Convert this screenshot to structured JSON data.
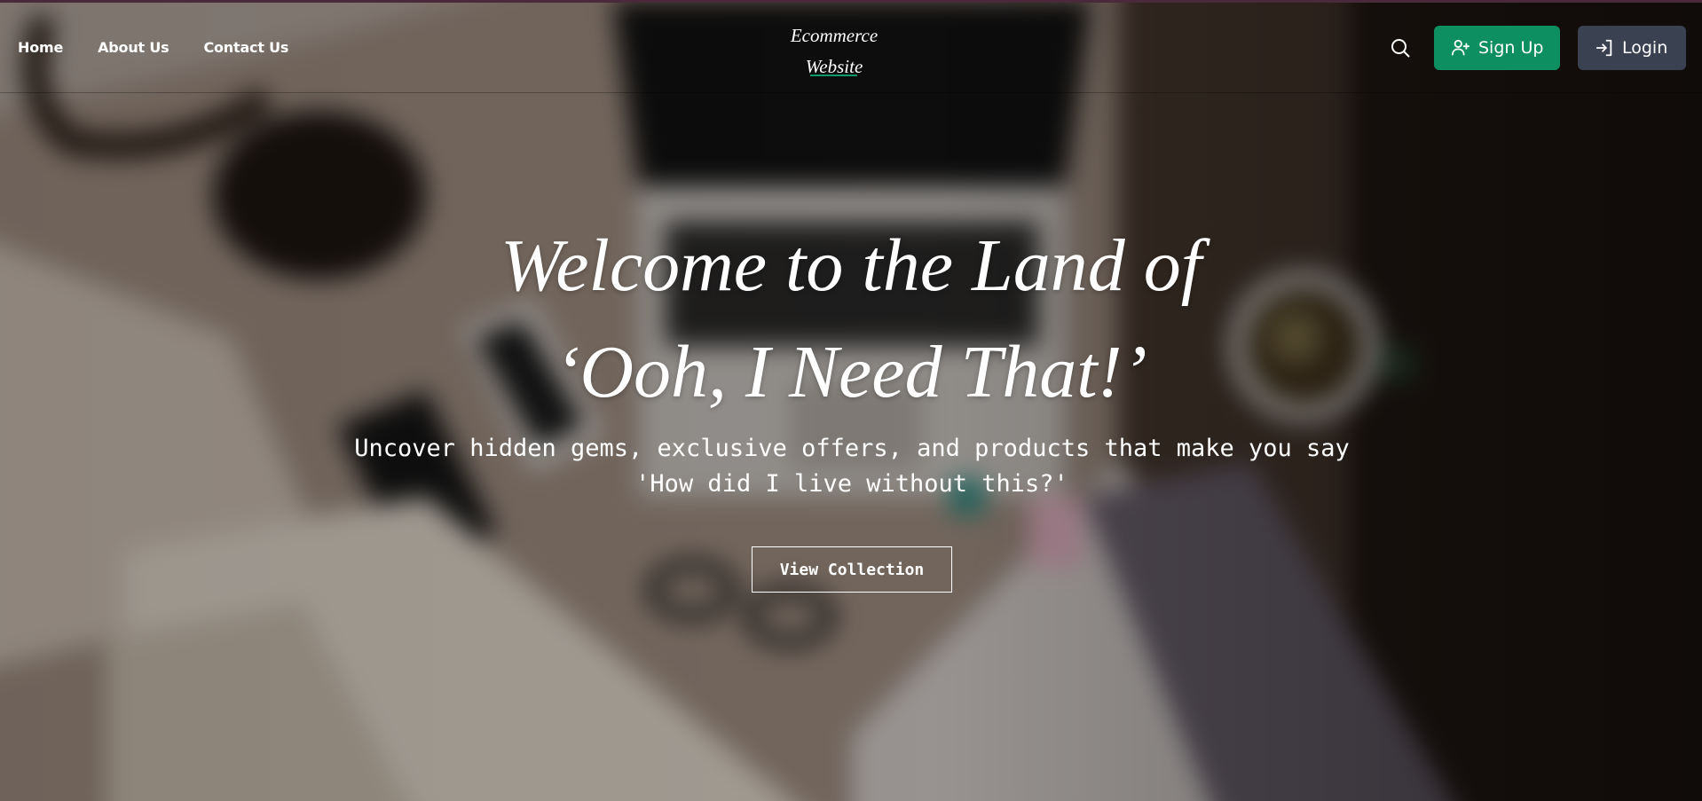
{
  "header": {
    "nav": [
      {
        "label": "Home"
      },
      {
        "label": "About Us"
      },
      {
        "label": "Contact Us"
      }
    ],
    "brand": {
      "line1": "Ecommerce",
      "line2": "Website"
    },
    "search_icon": "search-icon",
    "signup": {
      "label": "Sign Up",
      "icon": "user-plus-icon"
    },
    "login": {
      "label": "Login",
      "icon": "login-icon"
    }
  },
  "hero": {
    "title_line1": "Welcome to the Land of",
    "title_line2": "‘Ooh, I Need That!’",
    "subtitle_line1": "Uncover hidden gems, exclusive offers, and products that make you say",
    "subtitle_line2": "'How did I live without this?'",
    "cta_label": "View Collection"
  },
  "colors": {
    "accent_green": "#0e8f62",
    "login_button": "#3a4150",
    "text": "#ffffff"
  }
}
